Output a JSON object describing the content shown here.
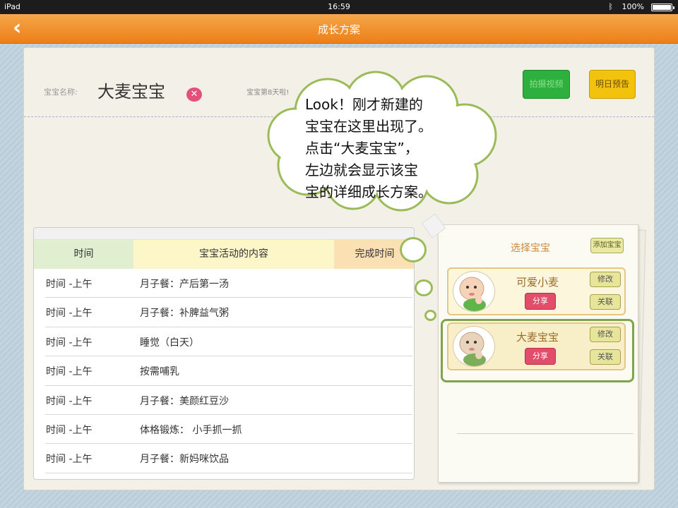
{
  "status_bar": {
    "device": "iPad",
    "time": "16:59",
    "battery": "100%"
  },
  "nav": {
    "back_label": "‹",
    "title": "成长方案"
  },
  "header": {
    "name_label": "宝宝名称:",
    "baby_name": "大麦宝宝",
    "delete_label": "✕",
    "days_text": "宝宝第8天啦!",
    "photo_button": "拍摄视频",
    "tomorrow_button": "明日预告"
  },
  "callout": {
    "lines": [
      "Look！刚才新建的",
      "宝宝在这里出现了。",
      "点击“大麦宝宝”，",
      "左边就会显示该宝",
      "宝的详细成长方案。"
    ]
  },
  "table": {
    "headers": [
      "时间",
      "宝宝活动的内容",
      "完成时间"
    ],
    "rows": [
      {
        "time": "时间  -上午",
        "content": "月子餐：产后第一汤"
      },
      {
        "time": "时间  -上午",
        "content": "月子餐：补脾益气粥"
      },
      {
        "time": "时间  -上午",
        "content": "睡觉（白天）"
      },
      {
        "time": "时间  -上午",
        "content": "按需哺乳"
      },
      {
        "time": "时间  -上午",
        "content": "月子餐：美颜红豆沙"
      },
      {
        "time": "时间  -上午",
        "content": "体格锻炼： 小手抓一抓"
      },
      {
        "time": "时间  -上午",
        "content": "月子餐：新妈咪饮品"
      }
    ]
  },
  "selector": {
    "title": "选择宝宝",
    "add_button": "添加宝宝",
    "cards": [
      {
        "name": "可爱小麦",
        "share": "分享",
        "edit": "修改",
        "link": "关联"
      },
      {
        "name": "大麦宝宝",
        "share": "分享",
        "edit": "修改",
        "link": "关联"
      }
    ]
  },
  "colors": {
    "accent": "#ec7f18",
    "callout_border": "#9bbb59",
    "share": "#e34d6c"
  }
}
